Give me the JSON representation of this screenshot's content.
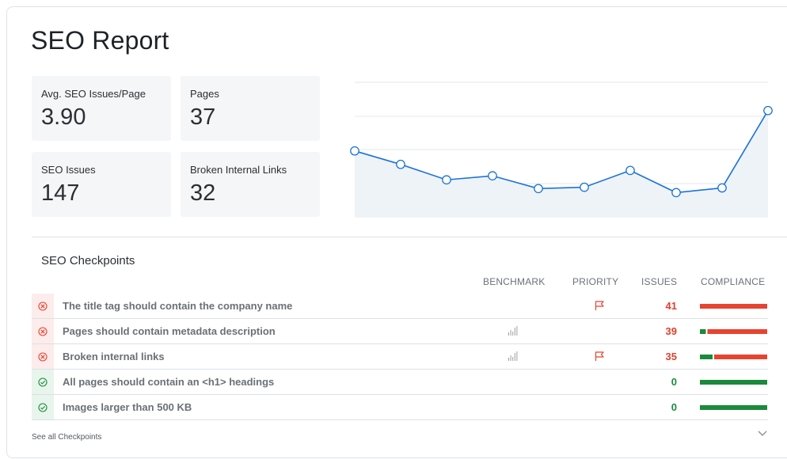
{
  "report": {
    "title": "SEO Report"
  },
  "stats": [
    {
      "label": "Avg. SEO Issues/Page",
      "value": "3.90"
    },
    {
      "label": "Pages",
      "value": "37"
    },
    {
      "label": "SEO Issues",
      "value": "147"
    },
    {
      "label": "Broken Internal Links",
      "value": "32"
    }
  ],
  "trend": {
    "values": [
      3.98,
      3.78,
      3.55,
      3.61,
      3.42,
      3.44,
      3.69,
      3.36,
      3.43,
      4.58
    ],
    "line_color": "#1a73d9",
    "fill_color": "#eef3f8"
  },
  "checkpoints": {
    "title": "SEO Checkpoints",
    "columns": {
      "benchmark": "BENCHMARK",
      "priority": "PRIORITY",
      "issues": "ISSUES",
      "compliance": "COMPLIANCE"
    },
    "rows": [
      {
        "status": "fail",
        "status_icon": "x-circle-icon",
        "name": "The title tag should contain the company name",
        "benchmark": false,
        "priority_flag": true,
        "issues": "41",
        "compliance_pass_fraction": 0.0
      },
      {
        "status": "fail",
        "status_icon": "x-circle-icon",
        "name": "Pages should contain metadata description",
        "benchmark": true,
        "priority_flag": false,
        "issues": "39",
        "compliance_pass_fraction": 0.1
      },
      {
        "status": "fail",
        "status_icon": "x-circle-icon",
        "name": "Broken internal links",
        "benchmark": true,
        "priority_flag": true,
        "issues": "35",
        "compliance_pass_fraction": 0.2
      },
      {
        "status": "pass",
        "status_icon": "check-circle-icon",
        "name": "All pages should contain an <h1> headings",
        "benchmark": false,
        "priority_flag": false,
        "issues": "0",
        "compliance_pass_fraction": 1.0
      },
      {
        "status": "pass",
        "status_icon": "check-circle-icon",
        "name": "Images larger than 500 KB",
        "benchmark": false,
        "priority_flag": false,
        "issues": "0",
        "compliance_pass_fraction": 1.0
      }
    ],
    "see_all": "See all Checkpoints"
  },
  "colors": {
    "fail": "#e8432f",
    "pass": "#1b8a3c"
  }
}
